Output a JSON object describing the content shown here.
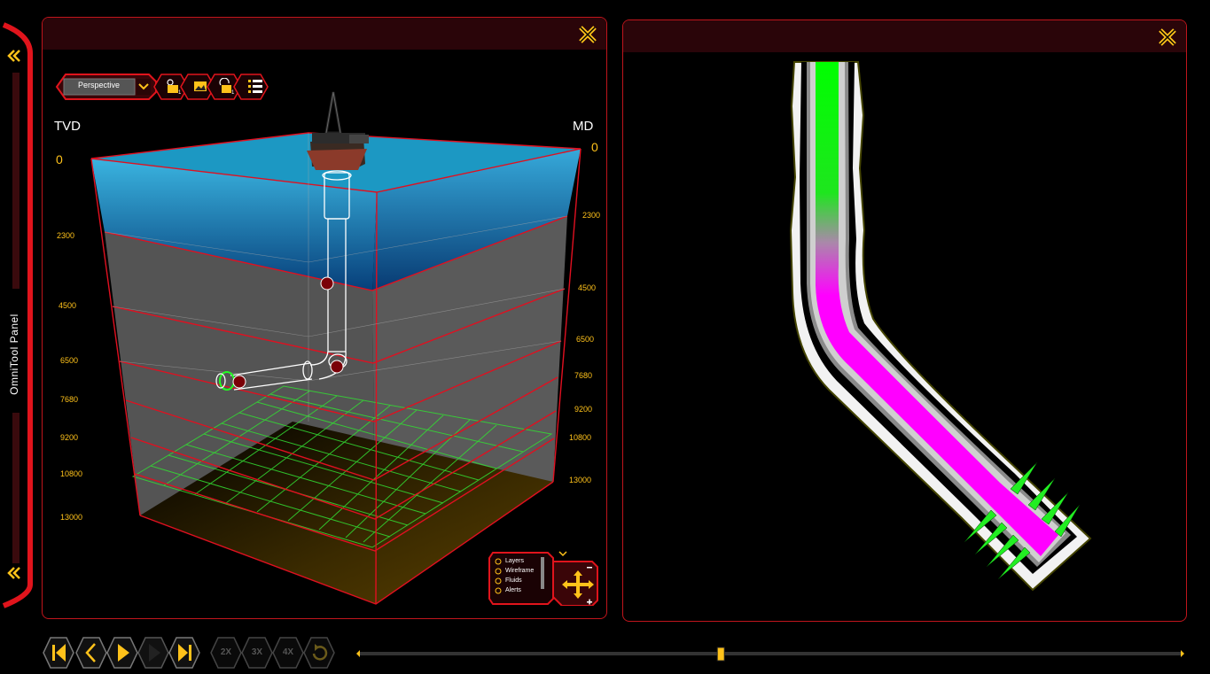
{
  "omnitool": {
    "label": "OmniTool Panel"
  },
  "left_panel": {
    "view_mode": "Perspective",
    "axis": {
      "tvd_title": "TVD",
      "md_title": "MD",
      "tvd_ticks": [
        "2300",
        "4500",
        "6500",
        "7680",
        "9200",
        "10800",
        "13000"
      ],
      "md_ticks": [
        "2300",
        "4500",
        "6500",
        "7680",
        "9200",
        "10800",
        "13000"
      ],
      "tvd_zero": "0",
      "md_zero": "0"
    },
    "legend": {
      "items": [
        "Layers",
        "Wireframe",
        "Fluids",
        "Alerts"
      ]
    }
  },
  "playback": {
    "speed_2x": "2X",
    "speed_3x": "3X",
    "speed_4x": "4X",
    "timeline_progress": 0.44
  },
  "colors": {
    "accent_red": "#c0151c",
    "header_bg": "#2a0509",
    "tick_yellow": "#ffc21a",
    "well_green": "#00ff00",
    "well_magenta": "#ff00ff"
  }
}
